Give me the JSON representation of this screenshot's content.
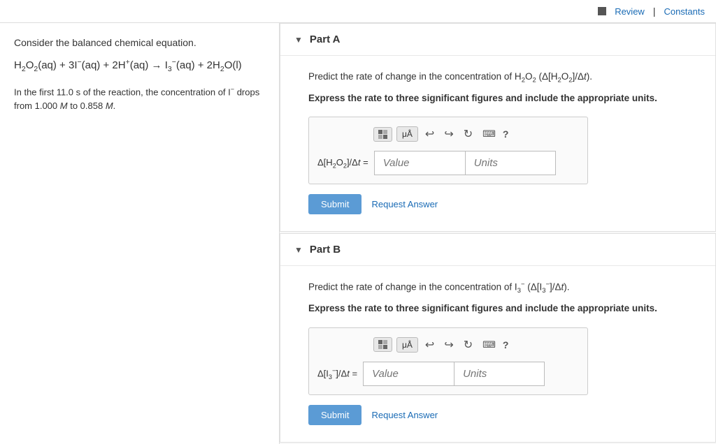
{
  "topbar": {
    "review_label": "Review",
    "separator": "|",
    "constants_label": "Constants"
  },
  "sidebar": {
    "intro": "Consider the balanced chemical equation.",
    "equation_text": "H₂O₂(aq) + 3I⁻(aq) + 2H⁺(aq) → I₃⁻(aq) + 2H₂O(l)",
    "note": "In the first 11.0 s of the reaction, the concentration of I⁻ drops from 1.000 M to 0.858 M."
  },
  "partA": {
    "label": "Part A",
    "question": "Predict the rate of change in the concentration of H₂O₂ (Δ[H₂O₂]/Δt).",
    "instruction": "Express the rate to three significant figures and include the appropriate units.",
    "input_label": "Δ[H₂O₂]/Δt =",
    "value_placeholder": "Value",
    "units_placeholder": "Units",
    "submit_label": "Submit",
    "request_label": "Request Answer"
  },
  "partB": {
    "label": "Part B",
    "question": "Predict the rate of change in the concentration of I₃⁻ (Δ[I₃⁻]/Δt).",
    "instruction": "Express the rate to three significant figures and include the appropriate units.",
    "input_label": "Δ[I₃⁻]/Δt =",
    "value_placeholder": "Value",
    "units_placeholder": "Units",
    "submit_label": "Submit",
    "request_label": "Request Answer"
  },
  "icons": {
    "undo": "↩",
    "redo": "↪",
    "refresh": "↻",
    "keyboard": "⌨",
    "help": "?"
  }
}
